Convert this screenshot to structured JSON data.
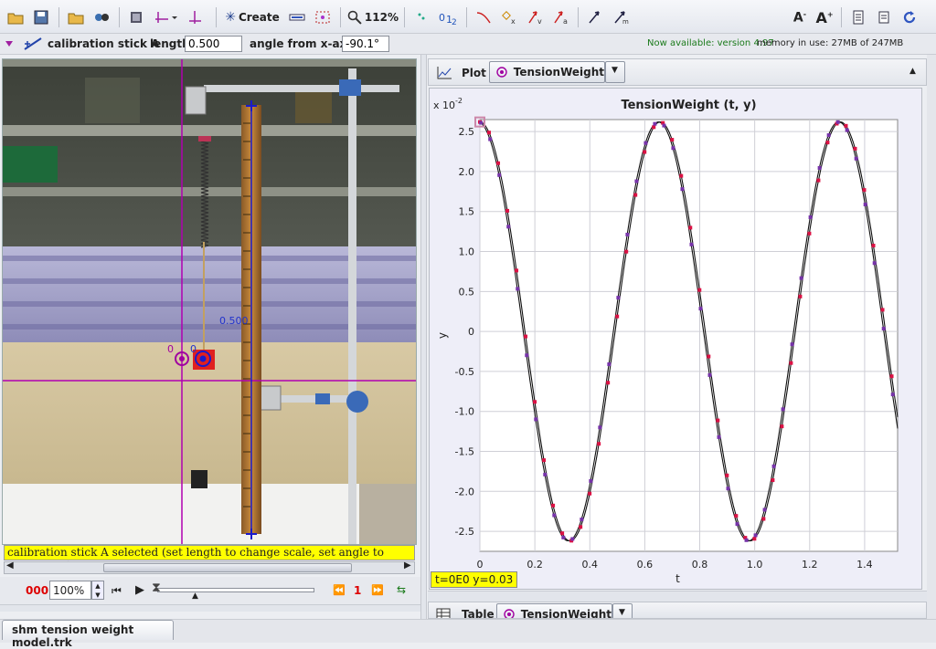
{
  "toolbar": {
    "create_label": "Create",
    "zoom_label": "112%",
    "buttons": [
      "open-icon",
      "save-icon",
      "open-video-icon",
      "video-effects-icon",
      "clip-settings-icon",
      "axes-icon",
      "tape-icon",
      "create-icon",
      "tracks-list-icon",
      "zoom-icon",
      "trail-icon",
      "labels-icon",
      "path-icon",
      "mark-icon",
      "velocity-icon",
      "acceleration-icon",
      "position-vector-icon",
      "momentum-vector-icon",
      "font-smaller-icon",
      "font-larger-icon",
      "notes-icon",
      "info-icon",
      "refresh-icon"
    ]
  },
  "property_bar": {
    "track_name": "calibration stick A",
    "length_label": "length",
    "length_value": "0.500",
    "angle_label": "angle from x-axis",
    "angle_value": "-90.1°",
    "update_notice": "Now available: version 4.97",
    "memory": "memory in use: 27MB of 247MB"
  },
  "video": {
    "status_message": "calibration stick A selected (set length to change scale, set angle to change tilt)",
    "stick_label": "0.500",
    "origin_label_left": "0",
    "origin_label_right": "0"
  },
  "player": {
    "frame_count": "000",
    "rate": "100%",
    "step_value": "1"
  },
  "plot_panel": {
    "view_label": "Plot",
    "track_selector": "TensionWeight",
    "coord_readout": "t=0E0  y=0.03"
  },
  "table_panel": {
    "view_label": "Table",
    "track_selector": "TensionWeight"
  },
  "file_tab": "shm tension weight model.trk",
  "chart_data": {
    "type": "line",
    "title": "TensionWeight (t, y)",
    "xlabel": "t",
    "ylabel": "y",
    "y_multiplier": "x 10",
    "y_multiplier_exp": "-2",
    "xlim": [
      0,
      1.52
    ],
    "ylim": [
      -2.75,
      2.65
    ],
    "x_ticks": [
      "0",
      "0.2",
      "0.4",
      "0.6",
      "0.8",
      "1.0",
      "1.2",
      "1.4"
    ],
    "x_tick_values": [
      0,
      0.2,
      0.4,
      0.6,
      0.8,
      1.0,
      1.2,
      1.4
    ],
    "y_ticks": [
      "2.5",
      "2.0",
      "1.5",
      "1.0",
      "0.5",
      "0",
      "-0.5",
      "-1.0",
      "-1.5",
      "-2.0",
      "-2.5"
    ],
    "y_tick_values": [
      2.5,
      2.0,
      1.5,
      1.0,
      0.5,
      0,
      -0.5,
      -1.0,
      -1.5,
      -2.0,
      -2.5
    ],
    "grid": true,
    "amplitude": 2.62,
    "period": 0.656,
    "series": [
      {
        "color": "#111111",
        "points": "line"
      },
      {
        "color": "#dd1144",
        "points": "markers"
      },
      {
        "color": "#7733aa",
        "points": "markers"
      }
    ]
  }
}
